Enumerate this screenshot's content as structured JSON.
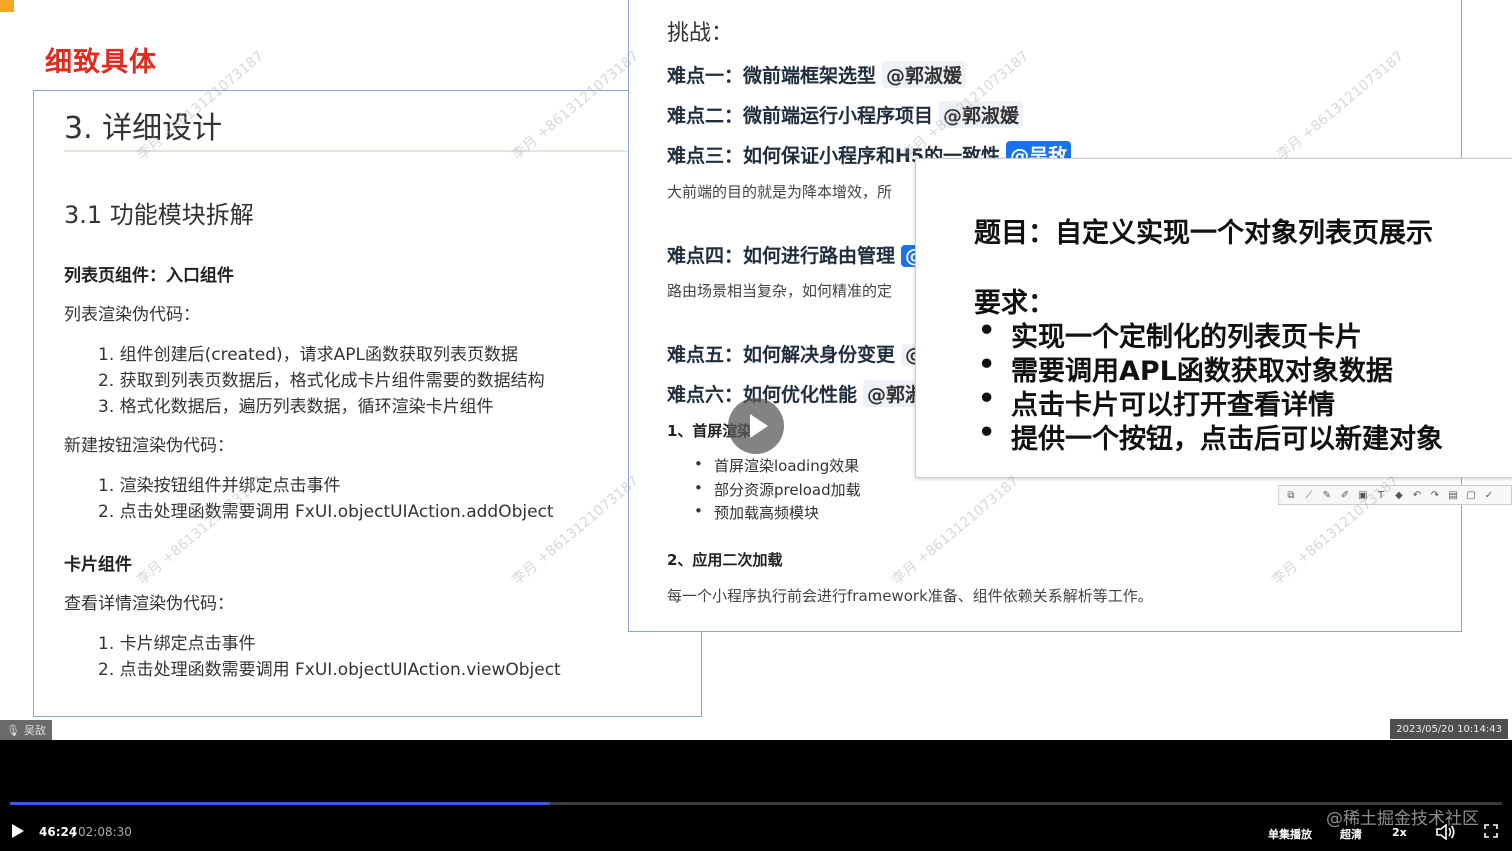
{
  "headline": "细致具体",
  "doc_left": {
    "h1": "3. 详细设计",
    "h2": "3.1 功能模块拆解",
    "list_page_heading": "列表页组件：入口组件",
    "list_render_label": "列表渲染伪代码：",
    "list_render_steps": [
      "1. 组件创建后(created)，请求APL函数获取列表页数据",
      "2. 获取到列表页数据后，格式化成卡片组件需要的数据结构",
      "3. 格式化数据后，遍历列表数据，循环渲染卡片组件"
    ],
    "new_button_label": "新建按钮渲染伪代码：",
    "new_button_steps": [
      "1. 渲染按钮组件并绑定点击事件",
      "2. 点击处理函数需要调用 FxUI.objectUIAction.addObject"
    ],
    "card_heading": "卡片组件",
    "view_detail_label": "查看详情渲染伪代码：",
    "view_detail_steps": [
      "1. 卡片绑定点击事件",
      "2. 点击处理函数需要调用 FxUI.objectUIAction.viewObject"
    ]
  },
  "doc_right": {
    "challenges_label": "挑战：",
    "d1": {
      "label": "难点一：微前端框架选型",
      "mention": "@郭淑媛"
    },
    "d2": {
      "label": "难点二：微前端运行小程序项目",
      "mention": "@郭淑媛"
    },
    "d3": {
      "label": "难点三：如何保证小程序和H5的一致性",
      "mention": "@吴敌"
    },
    "d3_desc": "大前端的目的就是为降本增效，所",
    "d4": {
      "label": "难点四：如何进行路由管理",
      "mention": "@"
    },
    "d4_desc": "路由场景相当复杂，如何精准的定",
    "d5": {
      "label": "难点五：如何解决身份变更",
      "mention": "@"
    },
    "d6": {
      "label": "难点六：如何优化性能",
      "mention": "@郭淑"
    },
    "perf1_title": "1、首屏渲染",
    "perf1_items": [
      "首屏渲染loading效果",
      "部分资源preload加载",
      "预加载高频模块"
    ],
    "perf2_title": "2、应用二次加载",
    "perf2_desc": "每一个小程序执行前会进行framework准备、组件依赖关系解析等工作。"
  },
  "task_card": {
    "title": "题目：自定义实现一个对象列表页展示",
    "requirements_label": "要求：",
    "items": [
      "实现一个定制化的列表页卡片",
      "需要调用APL函数获取对象数据",
      "点击卡片可以打开查看详情",
      "提供一个按钮，点击后可以新建对象"
    ]
  },
  "watermark_text": "李月 +8613121073187",
  "speaker_name": "吴敌",
  "recording_timestamp": "2023/05/20 10:14:43",
  "player": {
    "current_time": "46:24",
    "separator": "/",
    "total_time": "02:08:30",
    "progress_fraction": 0.362,
    "single_loop_label": "单集播放",
    "quality_label": "超清",
    "speed_label": "2x",
    "site_watermark": "@稀土掘金技术社区"
  },
  "colors": {
    "headline": "#e02b20",
    "mention_blue": "#1a73e8",
    "progress": "#3b5bdb"
  }
}
